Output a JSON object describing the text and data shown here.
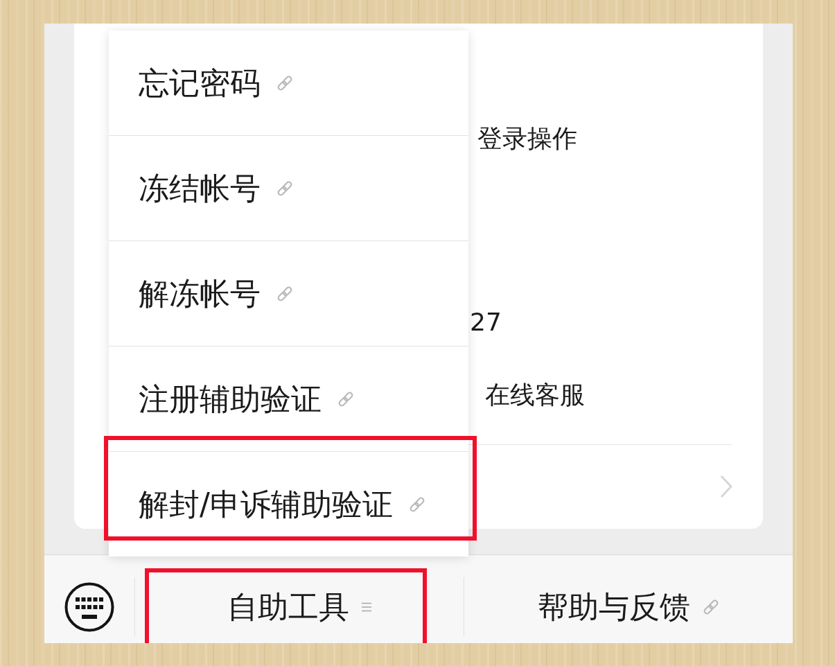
{
  "card": {
    "lines": [
      "登录操作",
      "27",
      "在线客服"
    ]
  },
  "menu": {
    "items": [
      {
        "label": "忘记密码",
        "highlighted": false
      },
      {
        "label": "冻结帐号",
        "highlighted": false
      },
      {
        "label": "解冻帐号",
        "highlighted": false
      },
      {
        "label": "注册辅助验证",
        "highlighted": false
      },
      {
        "label": "解封/申诉辅助验证",
        "highlighted": true
      }
    ]
  },
  "bottom_bar": {
    "buttons": [
      {
        "label": "自助工具",
        "kind": "menu",
        "highlighted": true
      },
      {
        "label": "帮助与反馈",
        "kind": "link",
        "highlighted": false
      }
    ]
  }
}
